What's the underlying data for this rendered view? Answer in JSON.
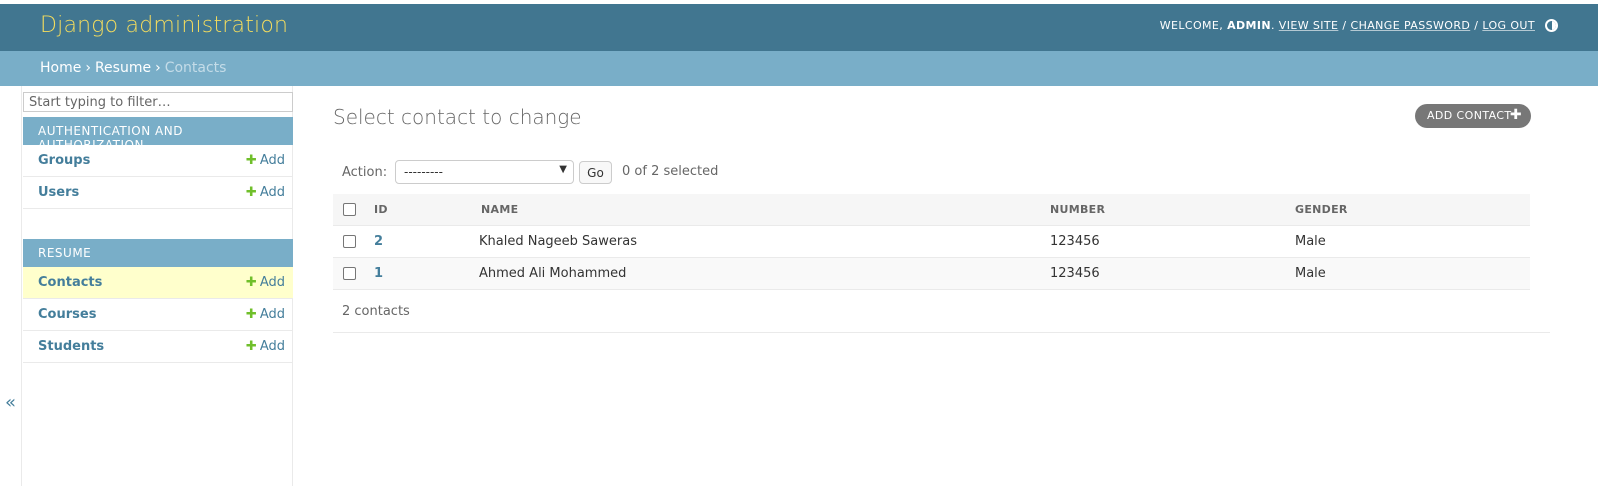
{
  "header": {
    "site_name": "Django administration",
    "welcome": "WELCOME,",
    "user": "ADMIN",
    "view_site": "VIEW SITE",
    "change_password": "CHANGE PASSWORD",
    "logout": "LOG OUT",
    "separator": "/"
  },
  "breadcrumbs": {
    "home": "Home",
    "app": "Resume",
    "current": "Contacts",
    "sep": "›"
  },
  "sidebar": {
    "filter_placeholder": "Start typing to filter…",
    "collapse_glyph": "«",
    "modules": [
      {
        "caption": "AUTHENTICATION AND AUTHORIZATION",
        "models": [
          {
            "name": "Groups",
            "add": "Add"
          },
          {
            "name": "Users",
            "add": "Add"
          }
        ]
      },
      {
        "caption": "RESUME",
        "models": [
          {
            "name": "Contacts",
            "add": "Add"
          },
          {
            "name": "Courses",
            "add": "Add"
          },
          {
            "name": "Students",
            "add": "Add"
          }
        ]
      }
    ]
  },
  "content": {
    "title": "Select contact to change",
    "add_button": "ADD CONTACT",
    "action_label": "Action:",
    "action_value": "---------",
    "go_label": "Go",
    "selected_count": "0 of 2 selected",
    "columns": [
      "ID",
      "NAME",
      "NUMBER",
      "GENDER"
    ],
    "rows": [
      {
        "id": "2",
        "name": "Khaled Nageeb Saweras",
        "number": "123456",
        "gender": "Male"
      },
      {
        "id": "1",
        "name": "Ahmed Ali Mohammed",
        "number": "123456",
        "gender": "Male"
      }
    ],
    "paginator": "2 contacts"
  },
  "colors": {
    "header_bg": "#417690",
    "site_name": "#f5dd5d",
    "breadcrumb_bg": "#79aec8",
    "link": "#447e9b",
    "add_icon": "#70bf2b",
    "current_row_bg": "#ffffcc"
  }
}
